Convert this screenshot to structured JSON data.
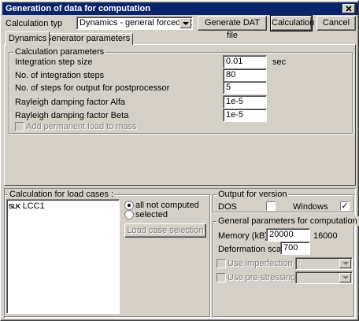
{
  "window": {
    "title": "Generation of data for computation"
  },
  "toolbar": {
    "calc_type_label": "Calculation typ",
    "calc_type_value": "Dynamics - general forced vibration (",
    "generate_dat_label": "Generate DAT file",
    "calculation_label": "Calculation",
    "cancel_label": "Cancel"
  },
  "tabs": [
    {
      "label": "Dynamics",
      "active": true
    },
    {
      "label": "Generator parameters",
      "active": false
    }
  ],
  "calc_params": {
    "group_label": "Calculation parameters",
    "rows": [
      {
        "label": "Integration step size",
        "value": "0.01",
        "unit": "sec"
      },
      {
        "label": "No. of integration steps",
        "value": "80"
      },
      {
        "label": "No. of steps for output for postprocessor",
        "value": "5"
      },
      {
        "label": "Rayleigh damping factor Alfa",
        "value": "1e-5"
      },
      {
        "label": "Rayleigh damping factor Beta",
        "value": "1e-5"
      }
    ],
    "add_load_label": "Add permanent load to mass"
  },
  "load_cases": {
    "group_label": "Calculation for load cases :",
    "items": [
      {
        "prefix": "SLK",
        "name": "LCC1"
      }
    ],
    "radio_all": "all not computed",
    "radio_selected": "selected",
    "selection_button": "Load case selection"
  },
  "output_version": {
    "group_label": "Output for version",
    "dos_label": "DOS",
    "windows_label": "Windows",
    "dos_checked": false,
    "windows_checked": true
  },
  "general_params": {
    "group_label": "General parameters for computation",
    "memory_label": "Memory (kB)",
    "memory_value": "20000",
    "memory_max": "16000",
    "deformation_label": "Deformation scale",
    "deformation_value": "700",
    "imperfection_label": "Use imperfection",
    "prestressing_label": "Use pre-stressing"
  },
  "icons": {
    "check_mark": "✓"
  }
}
